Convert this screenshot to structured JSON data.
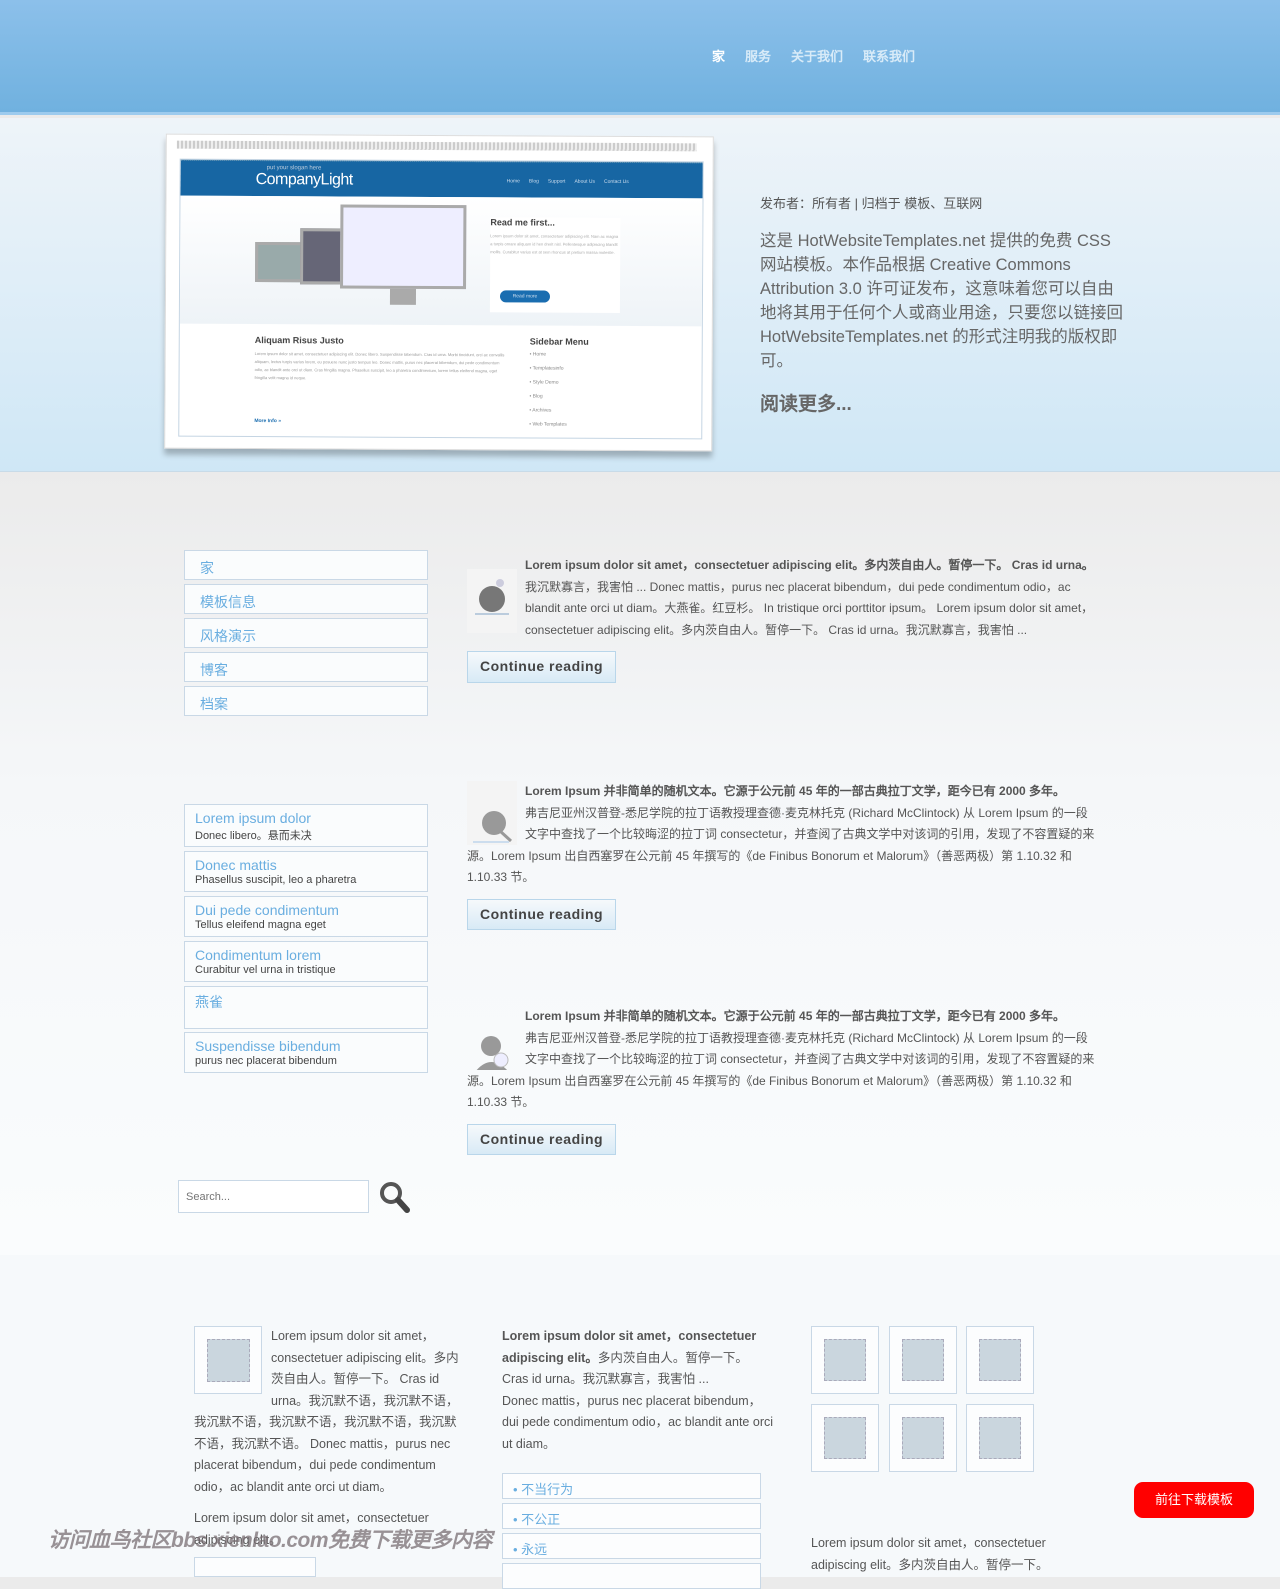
{
  "nav": {
    "items": [
      "家",
      "服务",
      "关于我们",
      "联系我们"
    ],
    "active": 0
  },
  "hero": {
    "mockup": {
      "slogan": "put your slogan here",
      "logo": "CompanyLight",
      "nav": [
        "Home",
        "Blog",
        "Support",
        "About Us",
        "Contact Us"
      ],
      "read_title": "Read me first...",
      "read_text": "Lorem ipsum dolor sit amet, consectetuer adipiscing elit. Nam ac magna a turpis ornare aliquam id hen drerit nisl. Pellentesque adipiscing blandit mollis. Curabitur varius est at sem rhoncus at pretium massa molestie.",
      "read_button": "Read more",
      "content_title": "Aliquam Risus Justo",
      "content_text": "Lorem ipsum dolor sit amet, consectetuer adipiscing elit. Donec libero. Suspendisse bibendum. Cras id urna. Morbi tincidunt, orci ac convallis aliquam, lectus turpis varius lorem, eu posuere nunc justo tempus leo. Donec mattis, purus nec placerat bibendum, dui pede condimentum odio, ac blandit ante orci ut diam. Cras fringilla magna. Phasellus suscipit, leo a pharetra condimentum, lorem tellus eleifend magna, eget fringilla velit magna id neque.",
      "more_info": "More Info »",
      "sidebar_title": "Sidebar Menu",
      "sidebar_items": [
        "Home",
        "Templatesinfo",
        "Style Demo",
        "Blog",
        "Archives",
        "Web Templates"
      ]
    },
    "meta": "发布者：所有者 | 归档于 模板、互联网",
    "intro": "这是 HotWebsiteTemplates.net 提供的免费 CSS 网站模板。本作品根据 Creative Commons Attribution 3.0 许可证发布，这意味着您可以自由地将其用于任何个人或商业用途，只要您以链接回 HotWebsiteTemplates.net 的形式注明我的版权即可。",
    "read_more": "阅读更多..."
  },
  "sidebar": {
    "menu": [
      "家",
      "模板信息",
      "风格演示",
      "博客",
      "档案"
    ],
    "links": [
      {
        "title": "Lorem ipsum dolor",
        "sub": "Donec libero。悬而未决"
      },
      {
        "title": "Donec mattis",
        "sub": "Phasellus suscipit, leo a pharetra"
      },
      {
        "title": "Dui pede condimentum",
        "sub": "Tellus eleifend magna eget"
      },
      {
        "title": "Condimentum lorem",
        "sub": "Curabitur vel urna in tristique"
      },
      {
        "title": "燕雀",
        "sub": ""
      },
      {
        "title": "Suspendisse bibendum",
        "sub": "purus nec placerat bibendum"
      }
    ],
    "search_placeholder": "Search..."
  },
  "posts": [
    {
      "icon": "bowling-icon",
      "lead": "Lorem ipsum dolor sit amet，consectetuer adipiscing elit。多内茨自由人。暂停一下。 Cras id urna。",
      "body": "我沉默寡言，我害怕 ... Donec mattis，purus nec placerat bibendum，dui pede condimentum odio，ac blandit ante orci ut diam。大燕雀。红豆杉。 In tristique orci porttitor ipsum。 Lorem ipsum dolor sit amet，consectetuer adipiscing elit。多内茨自由人。暂停一下。 Cras id urna。我沉默寡言，我害怕 ...",
      "button": "Continue reading"
    },
    {
      "icon": "ping-pong-icon",
      "lead": "Lorem Ipsum 并非简单的随机文本。它源于公元前 45 年的一部古典拉丁文学，距今已有 2000 多年。",
      "body": "弗吉尼亚州汉普登-悉尼学院的拉丁语教授理查德·麦克林托克 (Richard McClintock) 从 Lorem Ipsum 的一段文字中查找了一个比较晦涩的拉丁词 consectetur，并查阅了古典文学中对该词的引用，发现了不容置疑的来源。Lorem Ipsum 出自西塞罗在公元前 45 年撰写的《de Finibus Bonorum et Malorum》（善恶两极）第 1.10.32 和 1.10.33 节。",
      "button": "Continue reading"
    },
    {
      "icon": "user-search-icon",
      "lead": "Lorem Ipsum 并非简单的随机文本。它源于公元前 45 年的一部古典拉丁文学，距今已有 2000 多年。",
      "body": "弗吉尼亚州汉普登-悉尼学院的拉丁语教授理查德·麦克林托克 (Richard McClintock) 从 Lorem Ipsum 的一段文字中查找了一个比较晦涩的拉丁词 consectetur，并查阅了古典文学中对该词的引用，发现了不容置疑的来源。Lorem Ipsum 出自西塞罗在公元前 45 年撰写的《de Finibus Bonorum et Malorum》（善恶两极）第 1.10.32 和 1.10.33 节。",
      "button": "Continue reading"
    }
  ],
  "footer": {
    "col1_p1": "Lorem ipsum dolor sit amet，consectetuer adipiscing elit。多内茨自由人。暂停一下。 Cras id urna。我沉默不语，我沉默不语，我沉默不语，我沉默不语，我沉默不语，我沉默不语，我沉默不语。 Donec mattis，purus nec placerat bibendum，dui pede condimentum odio，ac blandit ante orci ut diam。",
    "col1_p2": "Lorem ipsum dolor sit amet，consectetuer adipiscing elit。",
    "col2_lead": "Lorem ipsum dolor sit amet，consectetuer adipiscing elit。",
    "col2_body": "多内茨自由人。暂停一下。 Cras id urna。我沉默寡言，我害怕 ...",
    "col2_p2": "Donec mattis，purus nec placerat bibendum，dui pede condimentum odio，ac blandit ante orci ut diam。",
    "col2_links": [
      "• 不当行为",
      "• 不公正",
      "• 永远"
    ],
    "col3_text": "Lorem ipsum dolor sit amet，consectetuer adipiscing elit。多内茨自由人。暂停一下。",
    "download_button": "前往下载模板"
  },
  "watermark": "访问血鸟社区bbs.xienlao.com免费下载更多内容",
  "colors": {
    "header": "#7ab6e4",
    "link": "#6aaee0",
    "download": "#ff0000",
    "mockup_header": "#1766a3"
  }
}
